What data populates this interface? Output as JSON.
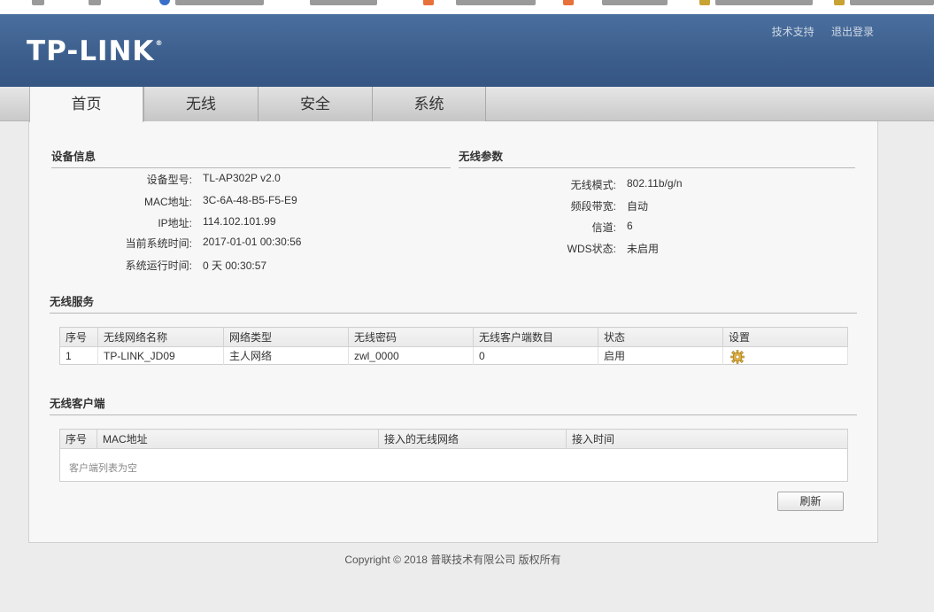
{
  "header": {
    "logo": "TP-LINK",
    "logo_reg": "®",
    "links": [
      "技术支持",
      "退出登录"
    ]
  },
  "tabs": [
    "首页",
    "无线",
    "安全",
    "系统"
  ],
  "device_info": {
    "title": "设备信息",
    "rows": [
      {
        "label": "设备型号:",
        "value": "TL-AP302P v2.0"
      },
      {
        "label": "MAC地址:",
        "value": "3C-6A-48-B5-F5-E9"
      },
      {
        "label": "IP地址:",
        "value": "114.102.101.99"
      },
      {
        "label": "当前系统时间:",
        "value": "2017-01-01 00:30:56"
      },
      {
        "label": "系统运行时间:",
        "value": "0 天 00:30:57"
      }
    ]
  },
  "wireless_params": {
    "title": "无线参数",
    "rows": [
      {
        "label": "无线模式:",
        "value": "802.11b/g/n"
      },
      {
        "label": "频段带宽:",
        "value": "自动"
      },
      {
        "label": "信道:",
        "value": "6"
      },
      {
        "label": "WDS状态:",
        "value": "未启用"
      }
    ]
  },
  "wireless_service": {
    "title": "无线服务",
    "columns": [
      "序号",
      "无线网络名称",
      "网络类型",
      "无线密码",
      "无线客户端数目",
      "状态",
      "设置"
    ],
    "rows": [
      {
        "index": "1",
        "ssid": "TP-LINK_JD09",
        "type": "主人网络",
        "password": "zwl_0000",
        "clients": "0",
        "status": "启用",
        "settings_icon": "gear-icon"
      }
    ]
  },
  "wireless_clients": {
    "title": "无线客户端",
    "columns": [
      "序号",
      "MAC地址",
      "接入的无线网络",
      "接入时间"
    ],
    "empty_text": "客户端列表为空"
  },
  "refresh_button": "刷新",
  "copyright": "Copyright © 2018 普联技术有限公司 版权所有",
  "colors": {
    "header_bg": "#3c5e8c",
    "panel_bg": "#f7f7f7",
    "page_bg": "#ececec"
  }
}
